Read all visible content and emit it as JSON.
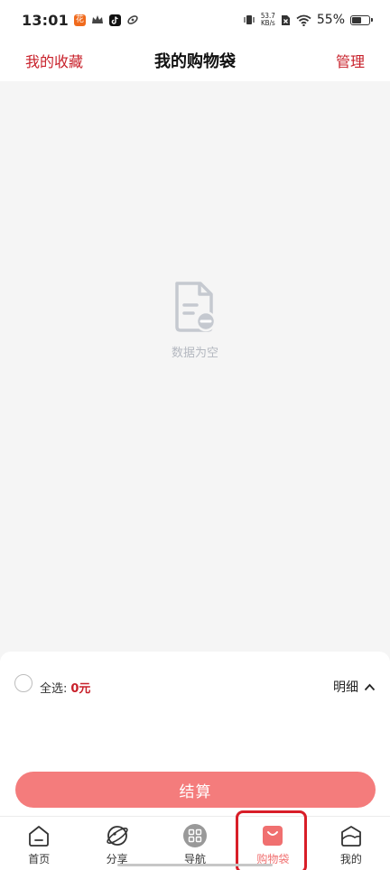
{
  "status_bar": {
    "time": "13:01",
    "app_badge": "花",
    "net_speed_value": "53.7",
    "net_speed_unit": "KB/s",
    "battery_percent": "55%",
    "battery_level": 0.55
  },
  "header": {
    "left_link": "我的收藏",
    "title": "我的购物袋",
    "right_link": "管理"
  },
  "empty_state": {
    "text": "数据为空"
  },
  "bottom_panel": {
    "select_all_label": "全选:",
    "total_amount": "0元",
    "detail_label": "明细",
    "checkout_label": "结算"
  },
  "tab_bar": {
    "tabs": [
      {
        "label": "首页",
        "icon": "home-icon"
      },
      {
        "label": "分享",
        "icon": "planet-icon"
      },
      {
        "label": "导航",
        "icon": "grid-icon"
      },
      {
        "label": "购物袋",
        "icon": "shopping-bag-icon"
      },
      {
        "label": "我的",
        "icon": "profile-icon"
      }
    ],
    "active_index": 3
  },
  "colors": {
    "accent": "#c8202a",
    "checkout_button": "#f47c7c",
    "active_tab": "#f07070",
    "highlight_box": "#d81e28"
  }
}
